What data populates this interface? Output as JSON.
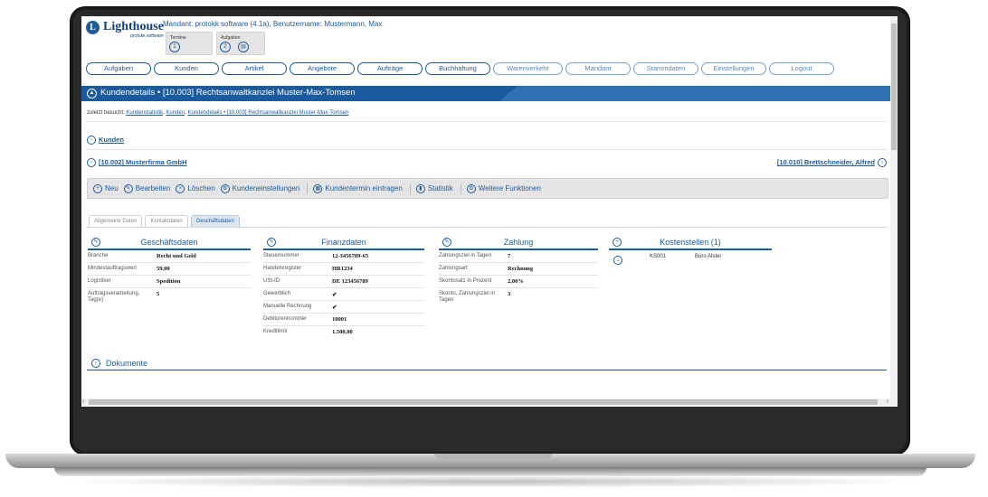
{
  "header": {
    "logo_mark": "L",
    "logo_name": "Lighthouse",
    "logo_sub": "protokk software",
    "mandant_info": "Mandant: protokk software (4.1a), Benutzername: Mustermann, Max",
    "widgets": [
      {
        "label": "Termine",
        "count": "1"
      },
      {
        "label": "Aufgaben",
        "count": "2",
        "icon": "list-icon"
      }
    ]
  },
  "nav": {
    "items": [
      {
        "label": "Aufgaben"
      },
      {
        "label": "Kunden"
      },
      {
        "label": "Artikel"
      },
      {
        "label": "Angebote"
      },
      {
        "label": "Aufträge"
      },
      {
        "label": "Buchhaltung"
      },
      {
        "label": "Warenverkehr"
      },
      {
        "label": "Mandant"
      },
      {
        "label": "Stammdaten"
      },
      {
        "label": "Einstellungen"
      },
      {
        "label": "Logout"
      }
    ]
  },
  "titlebar": {
    "title": "Kundendetails • [10.003] Rechtsanwaltkanzlei Muster-Max-Tomsen",
    "color": "#1b5a9e"
  },
  "visited": {
    "prefix": "zuletzt besucht:",
    "links": [
      "Kundenstatistik",
      "Kunden",
      "Kundendetails • [10.003] Rechtsanwaltkanzlei Muster-Max-Tomsen"
    ]
  },
  "back_link": "Kunden",
  "prev_customer": "[10.002] Musterfirma GmbH",
  "next_customer": "[10.010] Brettschneider, Alfred",
  "toolbar": {
    "neu": "Neu",
    "bearbeiten": "Bearbeiten",
    "loeschen": "Löschen",
    "kundeneinstellungen": "Kundeneinstellungen",
    "kundentermin": "Kundentermin eintragen",
    "statistik": "Statistik",
    "weitere": "Weitere Funktionen"
  },
  "tabs": [
    {
      "label": "Allgemeine Daten"
    },
    {
      "label": "Kontaktdaten"
    },
    {
      "label": "Geschäftsdaten"
    }
  ],
  "geschaeftsdaten": {
    "title": "Geschäftsdaten",
    "rows": [
      {
        "k": "Branche",
        "v": "Recht und Geld"
      },
      {
        "k": "Mindestauftragswert",
        "v": "59,00"
      },
      {
        "k": "Logistiker",
        "v": "Spedition"
      },
      {
        "k": "Auftragsverarbeitung, Tag(e)",
        "v": "5"
      }
    ]
  },
  "finanzdaten": {
    "title": "Finanzdaten",
    "rows": [
      {
        "k": "Steuernummer",
        "v": "12-3456789-65"
      },
      {
        "k": "Handelsregister",
        "v": "HR1234"
      },
      {
        "k": "USt-ID",
        "v": "DE 123456789"
      },
      {
        "k": "Gewerblich",
        "v": "✔"
      },
      {
        "k": "Manuelle Rechnung",
        "v": "✔"
      },
      {
        "k": "Debitorennummer",
        "v": "10001"
      },
      {
        "k": "Kreditlimit",
        "v": "1.500,00"
      }
    ]
  },
  "zahlung": {
    "title": "Zahlung",
    "rows": [
      {
        "k": "Zahlungsziel in Tagen",
        "v": "7"
      },
      {
        "k": "Zahlungsart",
        "v": "Rechnung"
      },
      {
        "k": "Skontosatz in Prozent",
        "v": "2,00%"
      },
      {
        "k": "Skonto, Zahlungsziel in Tagen",
        "v": "3"
      }
    ]
  },
  "kostenstellen": {
    "title": "Kostenstellen (1)",
    "rows": [
      {
        "code": "KS001",
        "name": "Büro Alster"
      }
    ]
  },
  "dokumente": "Dokumente"
}
